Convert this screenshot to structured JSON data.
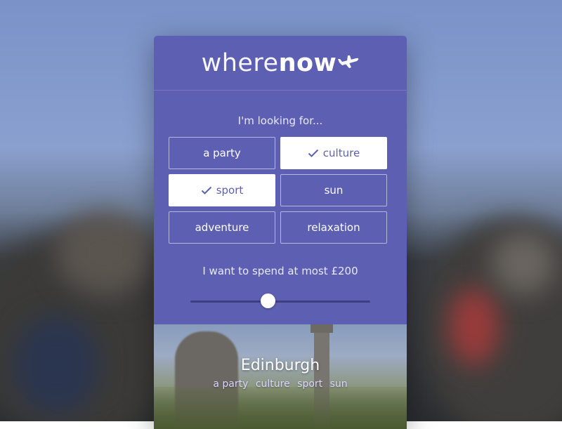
{
  "app": {
    "logo_light": "where",
    "logo_bold": "now",
    "logo_icon": "airplane-icon"
  },
  "filters": {
    "prompt": "I'm looking for...",
    "options": [
      {
        "label": "a party",
        "selected": false
      },
      {
        "label": "culture",
        "selected": true
      },
      {
        "label": "sport",
        "selected": true
      },
      {
        "label": "sun",
        "selected": false
      },
      {
        "label": "adventure",
        "selected": false
      },
      {
        "label": "relaxation",
        "selected": false
      }
    ],
    "check_icon": "checkmark-icon"
  },
  "budget": {
    "label": "I want to spend at most £200",
    "slider_value": 0.43
  },
  "result": {
    "city": "Edinburgh",
    "tags": [
      "a party",
      "culture",
      "sport",
      "sun"
    ]
  },
  "colors": {
    "accent": "#5d5fb3",
    "track": "#3e3f7f",
    "tag_text": "#d9d7ff"
  }
}
